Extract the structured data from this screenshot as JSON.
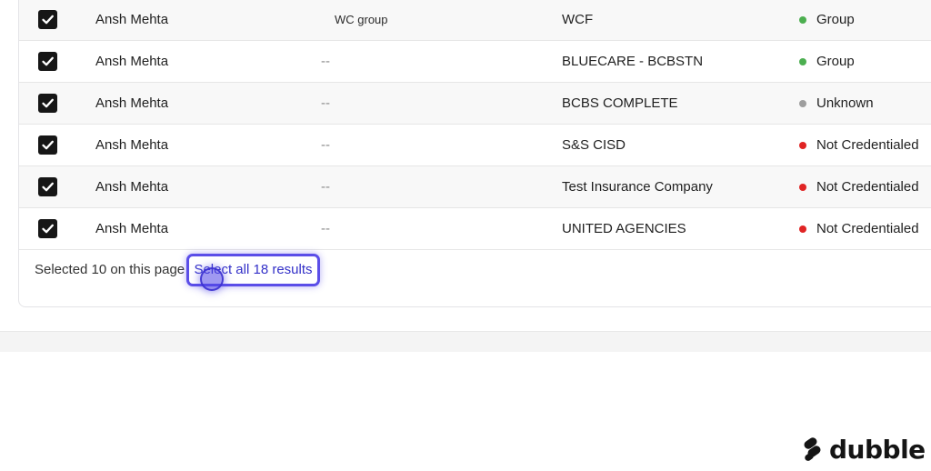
{
  "rows": [
    {
      "name": "Ansh Mehta",
      "group": "WC group",
      "payer": "WCF",
      "status": "Group",
      "status_color": "#4caf50",
      "checked": true
    },
    {
      "name": "Ansh Mehta",
      "group": "--",
      "payer": "BLUECARE - BCBSTN",
      "status": "Group",
      "status_color": "#4caf50",
      "checked": true
    },
    {
      "name": "Ansh Mehta",
      "group": "--",
      "payer": "BCBS COMPLETE",
      "status": "Unknown",
      "status_color": "#9e9e9e",
      "checked": true
    },
    {
      "name": "Ansh Mehta",
      "group": "--",
      "payer": "S&S CISD",
      "status": "Not Credentialed",
      "status_color": "#e02424",
      "checked": true
    },
    {
      "name": "Ansh Mehta",
      "group": "--",
      "payer": "Test Insurance Company",
      "status": "Not Credentialed",
      "status_color": "#e02424",
      "checked": true
    },
    {
      "name": "Ansh Mehta",
      "group": "--",
      "payer": "UNITED AGENCIES",
      "status": "Not Credentialed",
      "status_color": "#e02424",
      "checked": true
    }
  ],
  "footer": {
    "selected_text": "Selected 10 on this page",
    "select_all_label": "Select all 18 results"
  },
  "brand": {
    "logo_text": "dubble",
    "logo_icon": "dubble-logo-icon"
  },
  "colors": {
    "accent": "#5b4ee8",
    "link": "#3330c8"
  }
}
